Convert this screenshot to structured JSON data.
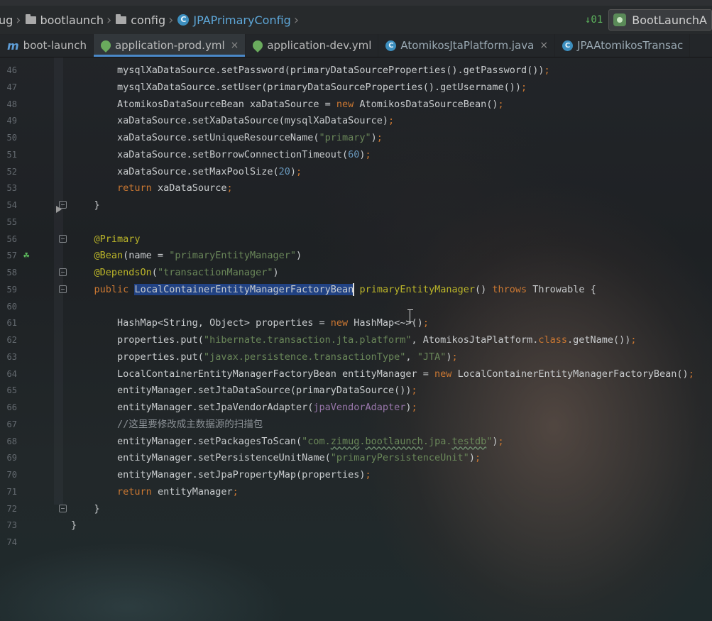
{
  "breadcrumb": {
    "items": [
      {
        "label": "ug",
        "kind": "text"
      },
      {
        "label": "bootlaunch",
        "kind": "folder"
      },
      {
        "label": "config",
        "kind": "folder"
      },
      {
        "label": "JPAPrimaryConfig",
        "kind": "class"
      }
    ],
    "class_icon_letter": "C"
  },
  "toolbar": {
    "vcs_icon": "vcs-update-icon",
    "vcs_glyph": "↓01",
    "run_config": "BootLaunchA"
  },
  "tabs": [
    {
      "label": "boot-launch",
      "icon": "m",
      "closable": false
    },
    {
      "label": "application-prod.yml",
      "icon": "yml",
      "closable": true
    },
    {
      "label": "application-dev.yml",
      "icon": "yml",
      "closable": false
    },
    {
      "label": "AtomikosJtaPlatform.java",
      "icon": "class",
      "closable": true
    },
    {
      "label": "JPAAtomikosTransac",
      "icon": "class",
      "closable": false
    }
  ],
  "close_glyph": "×",
  "editor": {
    "lines": [
      {
        "n": "46",
        "html": "        mysqlXaDataSource.setPassword(primaryDataSourceProperties().getPassword())<span class=\"kw\">;</span>"
      },
      {
        "n": "47",
        "html": "        mysqlXaDataSource.setUser(primaryDataSourceProperties().getUsername())<span class=\"kw\">;</span>"
      },
      {
        "n": "48",
        "html": "        AtomikosDataSourceBean xaDataSource = <span class=\"kw\">new</span> AtomikosDataSourceBean()<span class=\"kw\">;</span>"
      },
      {
        "n": "49",
        "html": "        xaDataSource.setXaDataSource(mysqlXaDataSource)<span class=\"kw\">;</span>"
      },
      {
        "n": "50",
        "html": "        xaDataSource.setUniqueResourceName(<span class=\"str\">\"primary\"</span>)<span class=\"kw\">;</span>"
      },
      {
        "n": "51",
        "html": "        xaDataSource.setBorrowConnectionTimeout(<span class=\"num\">60</span>)<span class=\"kw\">;</span>"
      },
      {
        "n": "52",
        "html": "        xaDataSource.setMaxPoolSize(<span class=\"num\">20</span>)<span class=\"kw\">;</span>"
      },
      {
        "n": "53",
        "html": "        <span class=\"kw\">return</span> xaDataSource<span class=\"kw\">;</span>"
      },
      {
        "n": "54",
        "html": "    }",
        "fold": true,
        "marker": true
      },
      {
        "n": "55",
        "html": ""
      },
      {
        "n": "56",
        "html": "    <span class=\"ann\">@Primary</span>",
        "fold": true
      },
      {
        "n": "57",
        "html": "    <span class=\"ann\">@Bean</span>(name = <span class=\"str\">\"primaryEntityManager\"</span>)",
        "bean": true
      },
      {
        "n": "58",
        "html": "    <span class=\"ann\">@DependsOn</span>(<span class=\"str\">\"transactionManager\"</span>)",
        "fold": true
      },
      {
        "n": "59",
        "html": "    <span class=\"kw\">public</span> <span class=\"sel\">LocalContainerEntityManagerFactoryBean</span><span class=\"caret\"></span> <span class=\"ann\">primaryEntityManager</span>() <span class=\"kw\">throws</span> Throwable {",
        "fold": true
      },
      {
        "n": "60",
        "html": ""
      },
      {
        "n": "61",
        "html": "        HashMap&lt;String, Object&gt; properties = <span class=\"kw\">new</span> HashMap&lt;~&gt;()<span class=\"kw\">;</span>"
      },
      {
        "n": "62",
        "html": "        properties.put(<span class=\"str\">\"hibernate.transaction.jta.platform\"</span>, AtomikosJtaPlatform.<span class=\"kw\">class</span>.getName())<span class=\"kw\">;</span>"
      },
      {
        "n": "63",
        "html": "        properties.put(<span class=\"str\">\"javax.persistence.transactionType\"</span>, <span class=\"str\">\"JTA\"</span>)<span class=\"kw\">;</span>"
      },
      {
        "n": "64",
        "html": "        LocalContainerEntityManagerFactoryBean entityManager = <span class=\"kw\">new</span> LocalContainerEntityManagerFactoryBean()<span class=\"kw\">;</span>"
      },
      {
        "n": "65",
        "html": "        entityManager.setJtaDataSource(primaryDataSource())<span class=\"kw\">;</span>"
      },
      {
        "n": "66",
        "html": "        entityManager.setJpaVendorAdapter(<span class=\"fld\">jpaVendorAdapter</span>)<span class=\"kw\">;</span>"
      },
      {
        "n": "67",
        "html": "        <span class=\"cmt\">//这里要修改成主数据源的扫描包</span>"
      },
      {
        "n": "68",
        "html": "        entityManager.setPackagesToScan(<span class=\"str\">\"com.<span class=\"squig\">zimug</span>.<span class=\"squig\">bootlaunch</span>.jpa.<span class=\"squig\">testdb</span>\"</span>)<span class=\"kw\">;</span>"
      },
      {
        "n": "69",
        "html": "        entityManager.setPersistenceUnitName(<span class=\"str\">\"primaryPersistenceUnit\"</span>)<span class=\"kw\">;</span>"
      },
      {
        "n": "70",
        "html": "        entityManager.setJpaPropertyMap(properties)<span class=\"kw\">;</span>"
      },
      {
        "n": "71",
        "html": "        <span class=\"kw\">return</span> entityManager<span class=\"kw\">;</span>"
      },
      {
        "n": "72",
        "html": "    }",
        "fold": true
      },
      {
        "n": "73",
        "html": "}"
      },
      {
        "n": "74",
        "html": ""
      }
    ]
  }
}
